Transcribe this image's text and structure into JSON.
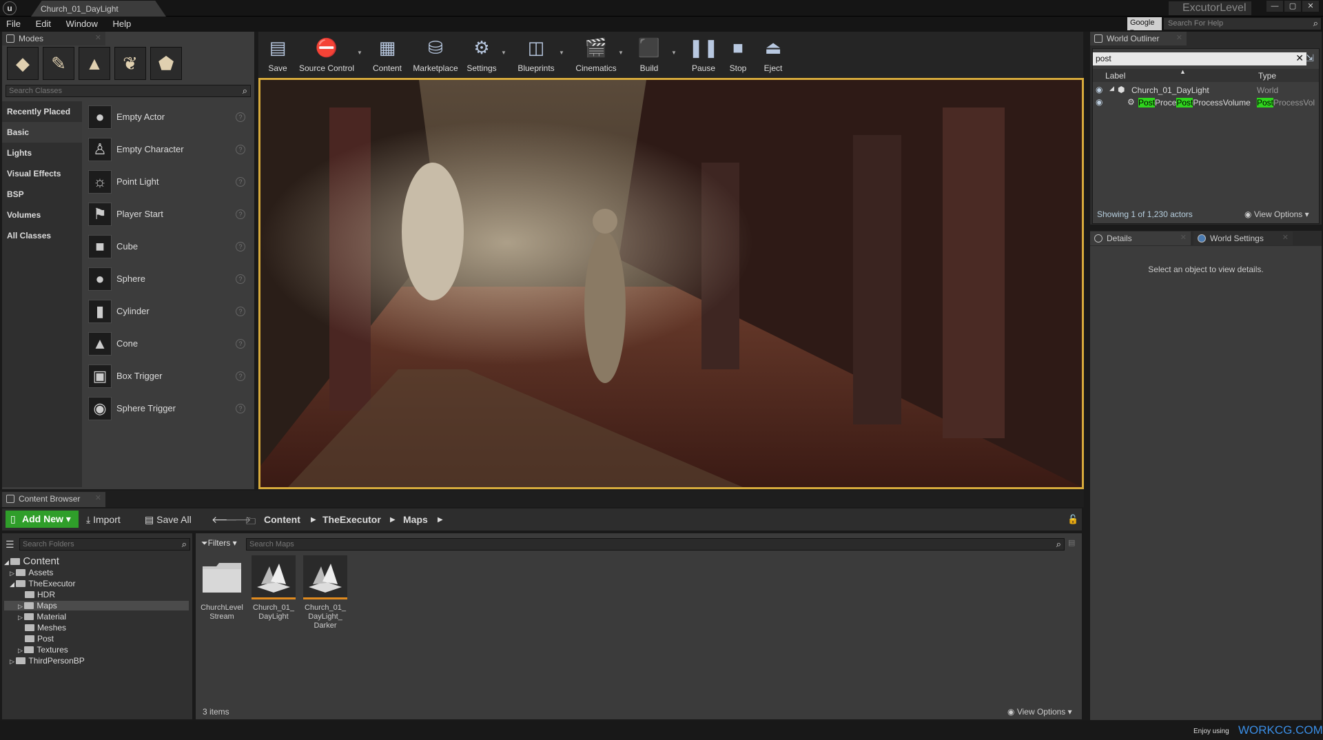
{
  "window": {
    "title": "Church_01_DayLight",
    "project": "ExcutorLevel"
  },
  "menu": [
    "File",
    "Edit",
    "Window",
    "Help"
  ],
  "help": {
    "engine": "Google",
    "placeholder": "Search For Help"
  },
  "modes": {
    "tab_label": "Modes",
    "search_placeholder": "Search Classes",
    "categories": [
      "Recently Placed",
      "Basic",
      "Lights",
      "Visual Effects",
      "BSP",
      "Volumes",
      "All Classes"
    ],
    "selected_category": "Basic",
    "classes": [
      "Empty Actor",
      "Empty Character",
      "Point Light",
      "Player Start",
      "Cube",
      "Sphere",
      "Cylinder",
      "Cone",
      "Box Trigger",
      "Sphere Trigger"
    ]
  },
  "toolbar": {
    "buttons": [
      "Save",
      "Source Control",
      "Content",
      "Marketplace",
      "Settings",
      "Blueprints",
      "Cinematics",
      "Build",
      "Pause",
      "Stop",
      "Eject"
    ]
  },
  "outliner": {
    "tab_label": "World Outliner",
    "search_value": "post",
    "col_label": "Label",
    "col_type": "Type",
    "rows": [
      {
        "label": "Church_01_DayLight",
        "type": "World"
      },
      {
        "label_pre": "Post",
        "label_mid": "Proce",
        "label_hl2": "Post",
        "label_post": "ProcessVolume",
        "type_hl": "Post",
        "type_rest": "ProcessVol"
      }
    ],
    "footer": "Showing 1 of 1,230 actors",
    "view_options": "View Options"
  },
  "details": {
    "tab_details": "Details",
    "tab_world": "World Settings",
    "message": "Select an object to view details."
  },
  "content_browser": {
    "tab_label": "Content Browser",
    "add_new": "Add New",
    "import": "Import",
    "save_all": "Save All",
    "breadcrumb": [
      "Content",
      "TheExecutor",
      "Maps"
    ],
    "folder_search_placeholder": "Search Folders",
    "filters_label": "Filters",
    "maps_search_placeholder": "Search Maps",
    "tree": {
      "root": "Content",
      "assets": "Assets",
      "the_executor": "TheExecutor",
      "hdr": "HDR",
      "maps": "Maps",
      "material": "Material",
      "meshes": "Meshes",
      "post": "Post",
      "textures": "Textures",
      "third_person": "ThirdPersonBP"
    },
    "assets": [
      {
        "line1": "ChurchLevel",
        "line2": "Stream",
        "line3": ""
      },
      {
        "line1": "Church_01_",
        "line2": "DayLight",
        "line3": ""
      },
      {
        "line1": "Church_01_",
        "line2": "DayLight_",
        "line3": "Darker"
      }
    ],
    "item_count": "3 items",
    "view_options": "View Options"
  },
  "status": {
    "enjoy": "Enjoy using",
    "brand": "WORKCG.COM"
  },
  "colors": {
    "accent_gold": "#d6aa3c",
    "add_green": "#2f9e2a",
    "highlight_green": "#2fd51d",
    "brand_blue": "#3a8ee6"
  }
}
